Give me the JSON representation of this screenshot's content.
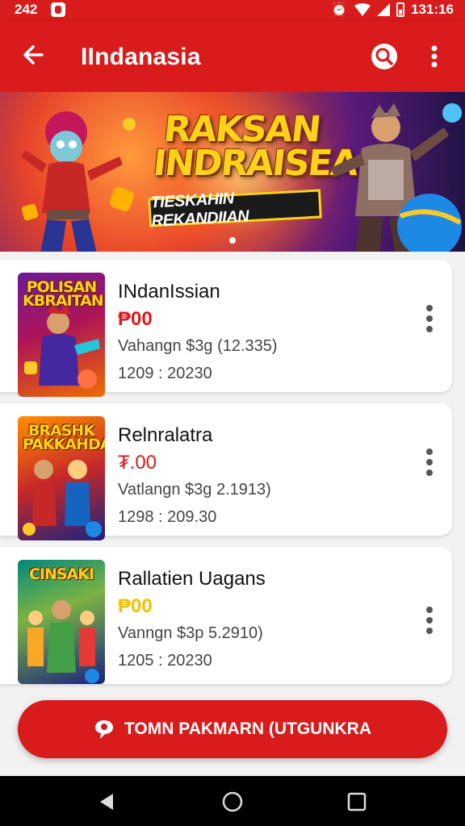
{
  "status_bar": {
    "time_left": "242",
    "time_right": "131:16",
    "icons": [
      "notification-icon",
      "alarm-icon",
      "wifi-icon",
      "signal-icon",
      "battery-icon"
    ]
  },
  "app_bar": {
    "title": "IIndanasia",
    "icons": [
      "back-arrow-icon",
      "search-icon",
      "more-vert-icon"
    ]
  },
  "banner": {
    "headline_line1": "RAKSAN",
    "headline_line2": "INDRAISEA",
    "tagline": "TIESKAHIN REKANDIIAN",
    "pager_dots": 1
  },
  "items": [
    {
      "name": "INdanIssian",
      "price": "₱00",
      "price_color": "#d81b1b",
      "meta": "Vahangn $3g (12.335)",
      "date": "1209 : 20230",
      "thumb_title": "POLISAN KBRAITAN"
    },
    {
      "name": "Relnralatra",
      "price": "₮.00",
      "price_color": "#d81b1b",
      "meta": "Vatlangn $3g 2.1913)",
      "date": "1298 : 209.30",
      "thumb_title": "BRASHK PAKKAHDAN"
    },
    {
      "name": "Rallatien Uagans",
      "price": "₱00",
      "price_color": "#f2c200",
      "meta": "Vanngn $3p 5.2910)",
      "date": "1205 : 20230",
      "thumb_title": "CINSAKI"
    }
  ],
  "cta": {
    "label": "TOMN PAKMARN (UTGUNKRA"
  },
  "colors": {
    "primary": "#d81b1b",
    "accent_yellow": "#ffd21a"
  }
}
